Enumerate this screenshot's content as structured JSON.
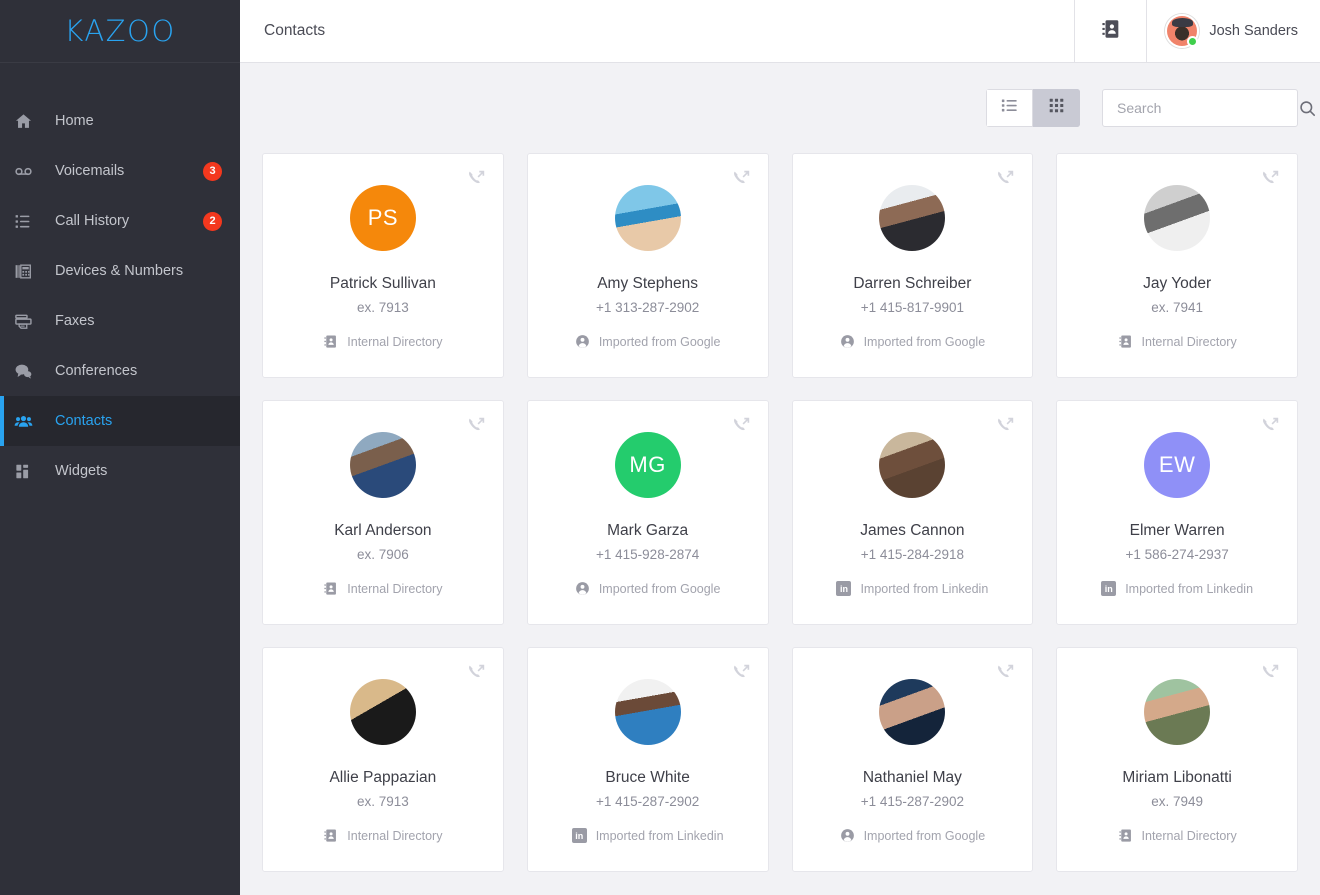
{
  "brand": {
    "logo": "KAZOO",
    "accent": "#29a3f0"
  },
  "sidebar": {
    "items": [
      {
        "label": "Home",
        "icon": "home-icon",
        "badge": null,
        "active": false
      },
      {
        "label": "Voicemails",
        "icon": "voicemail-icon",
        "badge": "3",
        "active": false
      },
      {
        "label": "Call History",
        "icon": "list-icon",
        "badge": "2",
        "active": false
      },
      {
        "label": "Devices & Numbers",
        "icon": "devices-icon",
        "badge": null,
        "active": false
      },
      {
        "label": "Faxes",
        "icon": "fax-icon",
        "badge": null,
        "active": false
      },
      {
        "label": "Conferences",
        "icon": "chat-icon",
        "badge": null,
        "active": false
      },
      {
        "label": "Contacts",
        "icon": "contacts-icon",
        "badge": null,
        "active": true
      },
      {
        "label": "Widgets",
        "icon": "widgets-icon",
        "badge": null,
        "active": false
      }
    ]
  },
  "topbar": {
    "title": "Contacts",
    "directory_icon": "address-book-icon",
    "user": {
      "name": "Josh Sanders",
      "status": "online",
      "status_color": "#3fcf4c"
    }
  },
  "toolbar": {
    "views": [
      {
        "name": "list-view",
        "icon": "list-view-icon",
        "active": false
      },
      {
        "name": "grid-view",
        "icon": "grid-view-icon",
        "active": true
      }
    ],
    "search": {
      "placeholder": "Search",
      "value": "",
      "icon": "search-icon"
    }
  },
  "contacts": [
    {
      "name": "Patrick Sullivan",
      "number": "ex. 7913",
      "source": "Internal Directory",
      "source_icon": "address-book-icon",
      "avatar_type": "initials",
      "initials": "PS",
      "avatar_color": "#f5880b",
      "photo_class": ""
    },
    {
      "name": "Amy Stephens",
      "number": "+1 313-287-2902",
      "source": "Imported from Google",
      "source_icon": "google-contact-icon",
      "avatar_type": "photo",
      "initials": "",
      "avatar_color": "",
      "photo_class": "ph-amy"
    },
    {
      "name": "Darren Schreiber",
      "number": "+1 415-817-9901",
      "source": "Imported from Google",
      "source_icon": "google-contact-icon",
      "avatar_type": "photo",
      "initials": "",
      "avatar_color": "",
      "photo_class": "ph-darren"
    },
    {
      "name": "Jay Yoder",
      "number": "ex. 7941",
      "source": "Internal Directory",
      "source_icon": "address-book-icon",
      "avatar_type": "photo",
      "initials": "",
      "avatar_color": "",
      "photo_class": "ph-jay"
    },
    {
      "name": "Karl Anderson",
      "number": "ex. 7906",
      "source": "Internal Directory",
      "source_icon": "address-book-icon",
      "avatar_type": "photo",
      "initials": "",
      "avatar_color": "",
      "photo_class": "ph-karl"
    },
    {
      "name": "Mark Garza",
      "number": "+1 415-928-2874",
      "source": "Imported from Google",
      "source_icon": "google-contact-icon",
      "avatar_type": "initials",
      "initials": "MG",
      "avatar_color": "#24cc6d",
      "photo_class": ""
    },
    {
      "name": "James Cannon",
      "number": "+1 415-284-2918",
      "source": "Imported from Linkedin",
      "source_icon": "linkedin-icon",
      "avatar_type": "photo",
      "initials": "",
      "avatar_color": "",
      "photo_class": "ph-james"
    },
    {
      "name": "Elmer Warren",
      "number": "+1 586-274-2937",
      "source": "Imported from Linkedin",
      "source_icon": "linkedin-icon",
      "avatar_type": "initials",
      "initials": "EW",
      "avatar_color": "#8f90f7",
      "photo_class": ""
    },
    {
      "name": "Allie Pappazian",
      "number": "ex. 7913",
      "source": "Internal Directory",
      "source_icon": "address-book-icon",
      "avatar_type": "photo",
      "initials": "",
      "avatar_color": "",
      "photo_class": "ph-allie"
    },
    {
      "name": "Bruce White",
      "number": "+1 415-287-2902",
      "source": "Imported from Linkedin",
      "source_icon": "linkedin-icon",
      "avatar_type": "photo",
      "initials": "",
      "avatar_color": "",
      "photo_class": "ph-bruce"
    },
    {
      "name": "Nathaniel May",
      "number": "+1 415-287-2902",
      "source": "Imported from Google",
      "source_icon": "google-contact-icon",
      "avatar_type": "photo",
      "initials": "",
      "avatar_color": "",
      "photo_class": "ph-nath"
    },
    {
      "name": "Miriam Libonatti",
      "number": "ex. 7949",
      "source": "Internal Directory",
      "source_icon": "address-book-icon",
      "avatar_type": "photo",
      "initials": "",
      "avatar_color": "",
      "photo_class": "ph-miriam"
    }
  ],
  "card_action": {
    "icon": "phone-outgoing-icon",
    "label": "Call"
  }
}
